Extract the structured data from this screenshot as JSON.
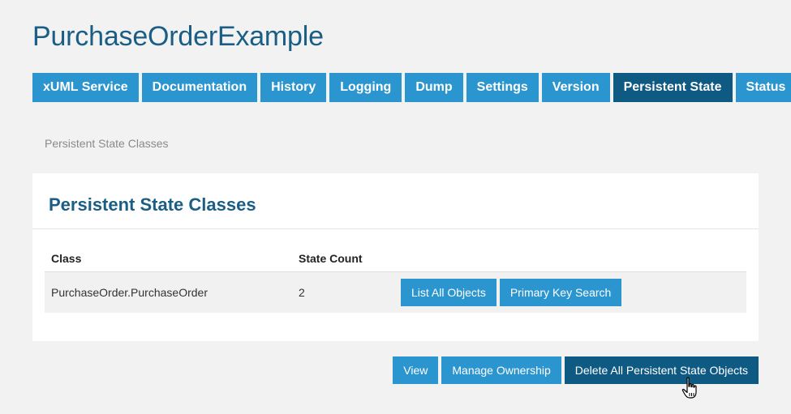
{
  "app": {
    "title": "PurchaseOrderExample"
  },
  "tabs": [
    {
      "label": "xUML Service",
      "active": false
    },
    {
      "label": "Documentation",
      "active": false
    },
    {
      "label": "History",
      "active": false
    },
    {
      "label": "Logging",
      "active": false
    },
    {
      "label": "Dump",
      "active": false
    },
    {
      "label": "Settings",
      "active": false
    },
    {
      "label": "Version",
      "active": false
    },
    {
      "label": "Persistent State",
      "active": true
    },
    {
      "label": "Status",
      "active": false
    }
  ],
  "breadcrumb": "Persistent State Classes",
  "panel": {
    "title": "Persistent State Classes",
    "table": {
      "headers": {
        "class": "Class",
        "state_count": "State Count"
      },
      "rows": [
        {
          "class": "PurchaseOrder.PurchaseOrder",
          "state_count": "2",
          "actions": {
            "list_all": "List All Objects",
            "pk_search": "Primary Key Search"
          }
        }
      ]
    }
  },
  "footer_actions": {
    "view": "View",
    "manage_ownership": "Manage Ownership",
    "delete_all": "Delete All Persistent State Objects"
  },
  "colors": {
    "primary": "#2b95cf",
    "active": "#0f5a82",
    "title": "#1a5e85",
    "background": "#f2f2f2"
  }
}
